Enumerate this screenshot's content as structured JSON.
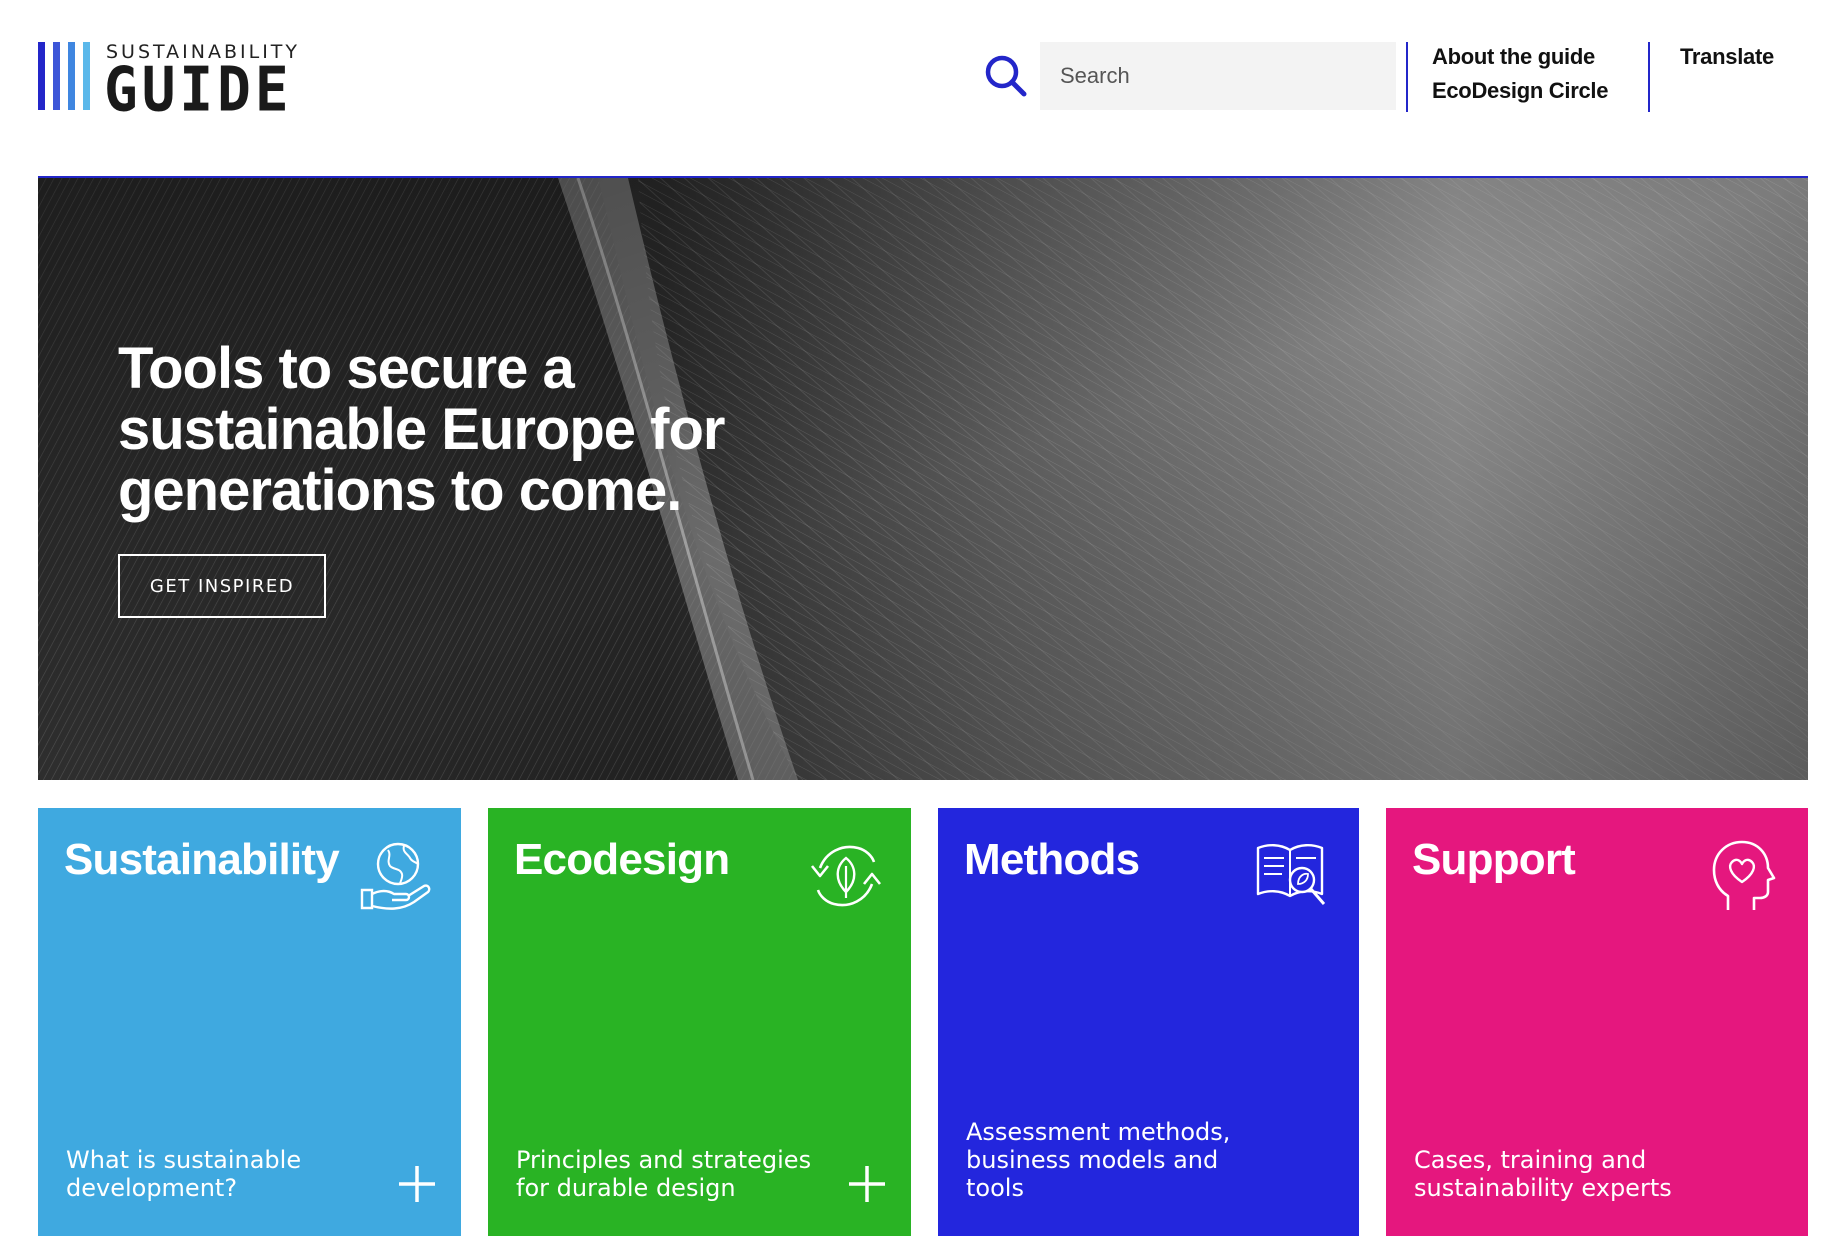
{
  "header": {
    "logo": {
      "top_text": "SUSTAINABILITY",
      "main_text": "GUIDE",
      "bar_colors": [
        "#2326c9",
        "#3d56d8",
        "#3f86e0",
        "#5bb8ea"
      ]
    },
    "search": {
      "placeholder": "Search"
    },
    "nav": {
      "about": "About the guide",
      "circle": "EcoDesign Circle",
      "translate": "Translate"
    },
    "accent": "#2326c9"
  },
  "hero": {
    "title": "Tools to secure a sustainable Europe for generations to come.",
    "button": "GET INSPIRED"
  },
  "cards": [
    {
      "title": "Sustainability",
      "description": "What is sustainable development?",
      "icon": "globe-in-hand-icon",
      "color": "#3fa9e0",
      "has_plus": true
    },
    {
      "title": "Ecodesign",
      "description": "Principles and strategies for durable design",
      "icon": "leaf-cycle-icon",
      "color": "#29b324",
      "has_plus": true
    },
    {
      "title": "Methods",
      "description": "Assessment methods, business models and tools",
      "icon": "book-magnifier-icon",
      "color": "#2326dd",
      "has_plus": false
    },
    {
      "title": "Support",
      "description": "Cases, training and sustainability experts",
      "icon": "head-heart-icon",
      "color": "#e5177e",
      "has_plus": false
    }
  ]
}
